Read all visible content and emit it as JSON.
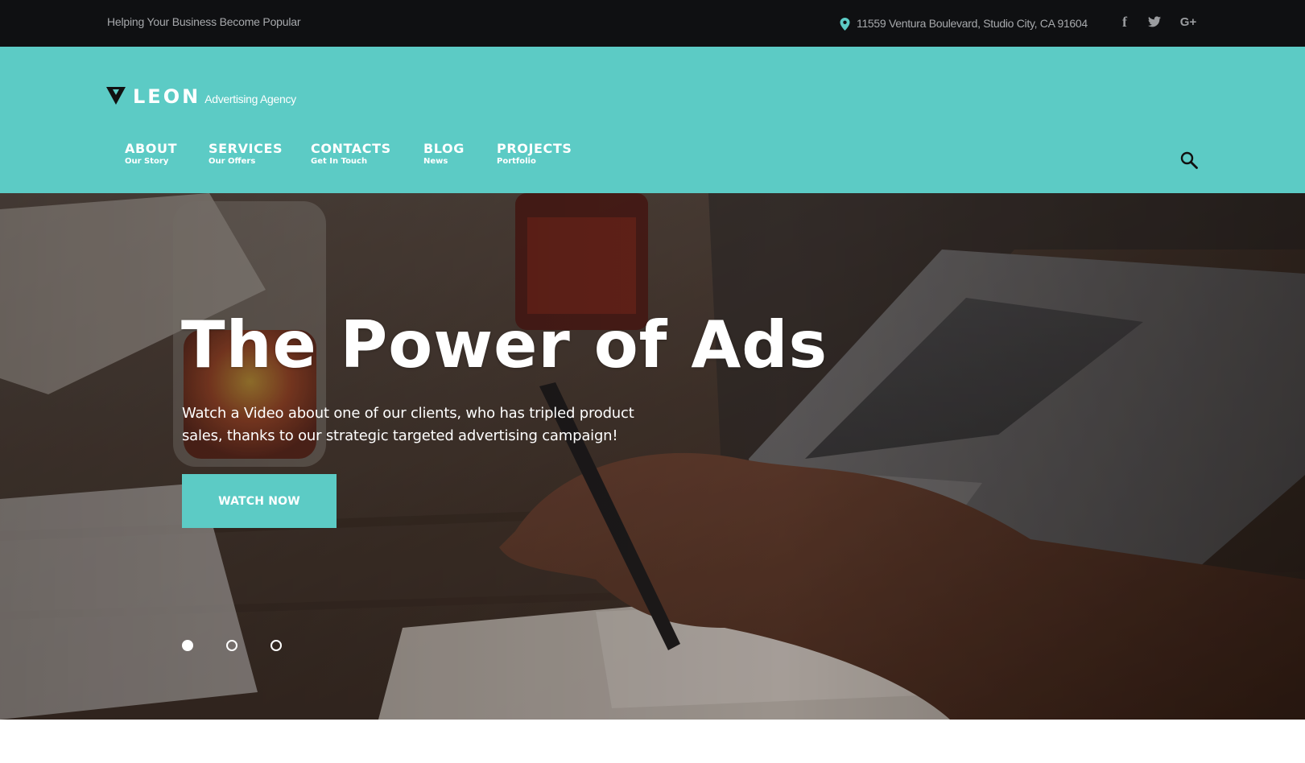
{
  "topbar": {
    "tagline": "Helping Your Business Become Popular",
    "address": "11559 Ventura Boulevard, Studio City, CA 91604",
    "pin_icon": "map-pin-icon",
    "social": [
      {
        "name": "facebook-icon",
        "glyph": "f"
      },
      {
        "name": "twitter-icon",
        "glyph": "t"
      },
      {
        "name": "google-plus-icon",
        "glyph": "G+"
      }
    ]
  },
  "header": {
    "logo": {
      "name": "LEON",
      "subtitle": "Advertising Agency"
    },
    "nav": [
      {
        "label": "ABOUT",
        "sub": "Our Story"
      },
      {
        "label": "SERVICES",
        "sub": "Our Offers"
      },
      {
        "label": "CONTACTS",
        "sub": "Get In Touch"
      },
      {
        "label": "BLOG",
        "sub": "News"
      },
      {
        "label": "PROJECTS",
        "sub": "Portfolio"
      }
    ],
    "search_icon": "search-icon"
  },
  "hero": {
    "title": "The Power of Ads",
    "description": "Watch a Video about one of our clients, who has tripled product sales, thanks to our strategic targeted advertising campaign!",
    "button_label": "WATCH NOW",
    "slides_total": 3,
    "active_slide": 1
  },
  "colors": {
    "accent": "#5ccbc5",
    "topbar_bg": "#0f1012",
    "topbar_text": "#a7a9ac",
    "white": "#ffffff"
  }
}
